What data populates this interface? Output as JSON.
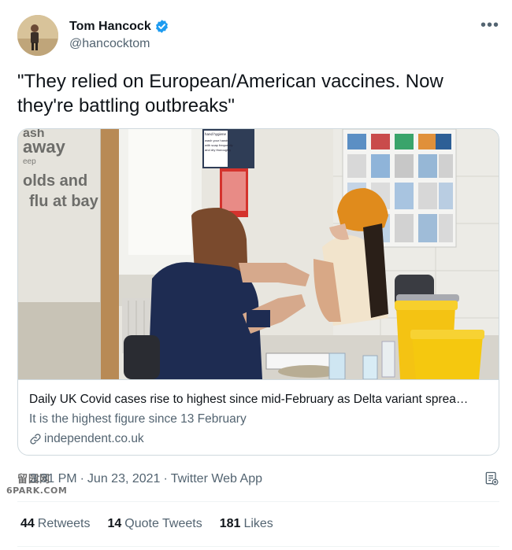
{
  "author": {
    "display_name": "Tom Hancock",
    "handle": "@hancocktom",
    "verified_icon": "verified-badge-icon",
    "avatar_icon": "avatar"
  },
  "more_icon": "more-options-icon",
  "tweet_text": "\"They relied on European/American vaccines. Now they're battling outbreaks\"",
  "card": {
    "title": "Daily UK Covid cases rise to highest since mid-February as Delta variant sprea…",
    "description": "It is the highest figure since 13 February",
    "domain": "independent.co.uk",
    "image_icon": "vaccination-photo",
    "image_text": {
      "poster_lines": [
        "ash",
        "away",
        "eep",
        "olds and",
        "flu at bay"
      ],
      "sign_lines": [
        "hand hygiene",
        "wash your hands",
        "with soap frequently",
        "and dry thoroughly"
      ]
    }
  },
  "timestamp": {
    "time": "3:31 PM",
    "date": "Jun 23, 2021",
    "source": "Twitter Web App"
  },
  "watermark": {
    "top": "留园网",
    "bottom": "6PARK.COM"
  },
  "stats": {
    "retweets_count": "44",
    "retweets_label": "Retweets",
    "quotes_count": "14",
    "quotes_label": "Quote Tweets",
    "likes_count": "181",
    "likes_label": "Likes"
  },
  "colors": {
    "text": "#0f1419",
    "secondary": "#536471",
    "verified": "#1d9bf0",
    "border": "#cfd9de"
  }
}
